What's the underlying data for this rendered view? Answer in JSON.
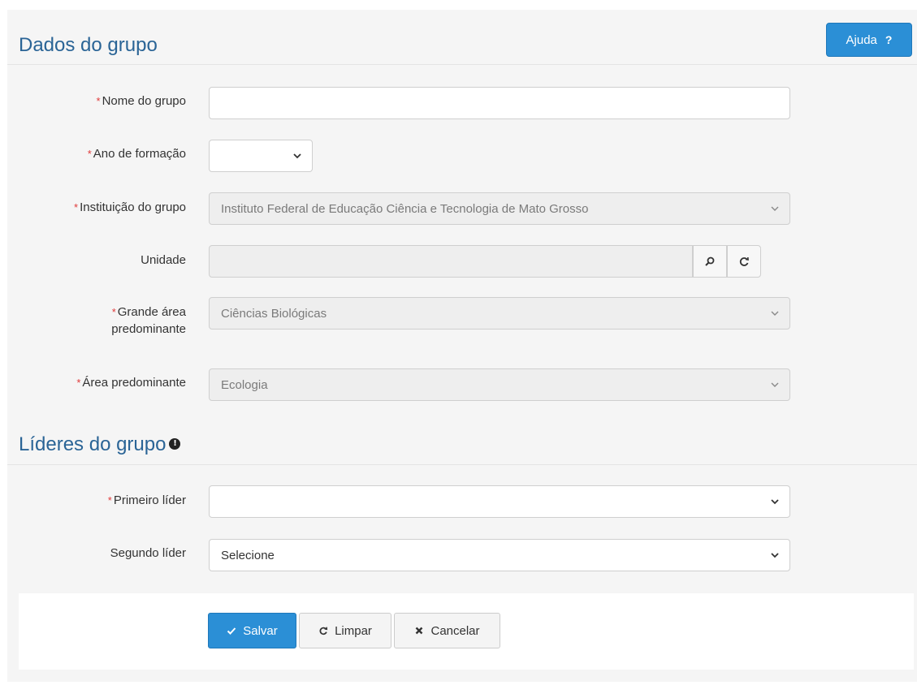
{
  "section1": {
    "title": "Dados do grupo"
  },
  "help_button": {
    "label": "Ajuda",
    "icon": "question-icon",
    "icon_text": "?"
  },
  "form": {
    "required_marker": "*",
    "nome_do_grupo": {
      "label": "Nome do grupo",
      "value": ""
    },
    "ano_de_formacao": {
      "label": "Ano de formação",
      "value": ""
    },
    "instituicao": {
      "label": "Instituição do grupo",
      "value": "Instituto Federal de Educação Ciência e Tecnologia de Mato Grosso"
    },
    "unidade": {
      "label": "Unidade",
      "value": ""
    },
    "grande_area": {
      "label_line1": "Grande área",
      "label_line2": "predominante",
      "value": "Ciências Biológicas"
    },
    "area_predominante": {
      "label": "Área predominante",
      "value": "Ecologia"
    }
  },
  "section2": {
    "title": "Líderes do grupo",
    "info_icon_text": "!"
  },
  "leaders": {
    "primeiro": {
      "label": "Primeiro líder",
      "value": ""
    },
    "segundo": {
      "label": "Segundo líder",
      "value": "Selecione"
    }
  },
  "footer": {
    "save_label": "Salvar",
    "clear_label": "Limpar",
    "cancel_label": "Cancelar"
  },
  "colors": {
    "accent": "#2b8fd6",
    "title": "#2a6496",
    "required": "#e03a3a"
  }
}
